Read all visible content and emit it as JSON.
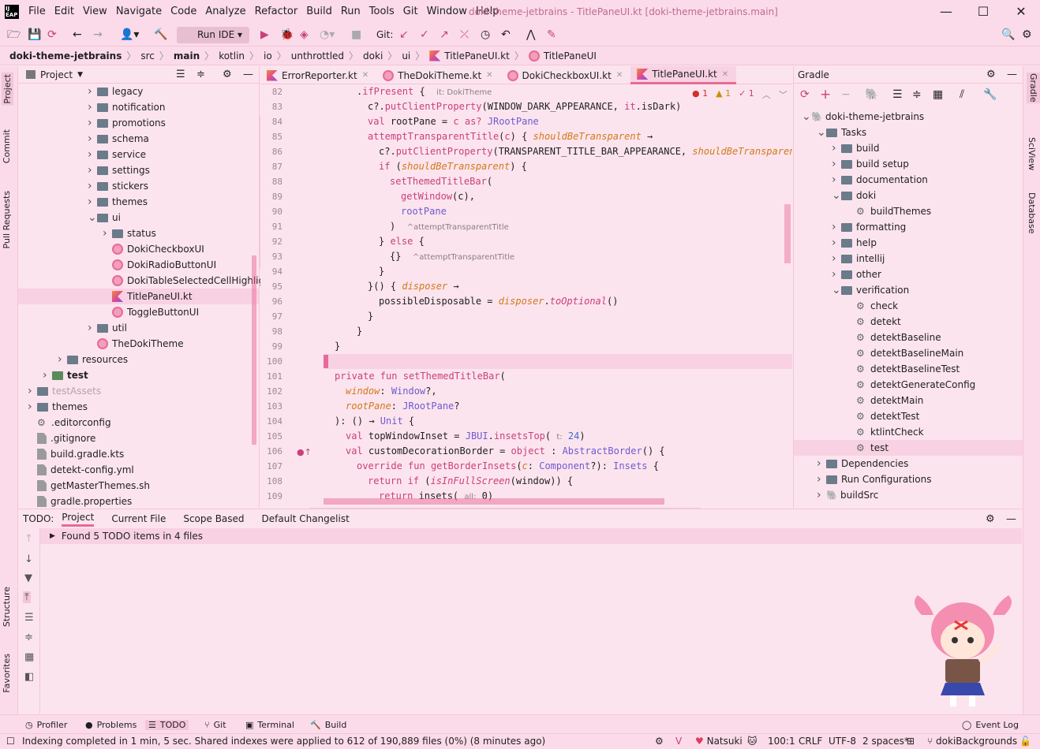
{
  "window": {
    "logo": "IJ EAP",
    "title": "doki-theme-jetbrains - TitlePaneUI.kt [doki-theme-jetbrains.main]",
    "min": "—",
    "max": "☐",
    "close": "✕"
  },
  "menu": [
    "File",
    "Edit",
    "View",
    "Navigate",
    "Code",
    "Analyze",
    "Refactor",
    "Build",
    "Run",
    "Tools",
    "Git",
    "Window",
    "Help"
  ],
  "toolbar": {
    "run_config": "Run IDE",
    "git_label": "Git:"
  },
  "breadcrumb": [
    "doki-theme-jetbrains",
    "src",
    "main",
    "kotlin",
    "io",
    "unthrottled",
    "doki",
    "ui",
    "TitlePaneUI.kt",
    "TitlePaneUI"
  ],
  "left_strip": [
    "Project",
    "Commit",
    "Pull Requests",
    "Structure",
    "Favorites"
  ],
  "right_strip": [
    "Gradle",
    "SciView",
    "Database"
  ],
  "project": {
    "title": "Project",
    "items": [
      {
        "label": "legacy",
        "type": "folder"
      },
      {
        "label": "notification",
        "type": "folder"
      },
      {
        "label": "promotions",
        "type": "folder"
      },
      {
        "label": "schema",
        "type": "folder"
      },
      {
        "label": "service",
        "type": "folder"
      },
      {
        "label": "settings",
        "type": "folder"
      },
      {
        "label": "stickers",
        "type": "folder"
      },
      {
        "label": "themes",
        "type": "folder"
      },
      {
        "label": "ui",
        "type": "folder"
      },
      {
        "label": "status",
        "type": "folder"
      },
      {
        "label": "DokiCheckboxUI",
        "type": "class"
      },
      {
        "label": "DokiRadioButtonUI",
        "type": "class"
      },
      {
        "label": "DokiTableSelectedCellHighlightBorder",
        "type": "class"
      },
      {
        "label": "TitlePaneUI.kt",
        "type": "kt"
      },
      {
        "label": "ToggleButtonUI",
        "type": "class"
      },
      {
        "label": "util",
        "type": "folder"
      },
      {
        "label": "TheDokiTheme",
        "type": "class"
      },
      {
        "label": "resources",
        "type": "folder"
      },
      {
        "label": "test",
        "type": "testfolder"
      },
      {
        "label": "testAssets",
        "type": "folder"
      },
      {
        "label": "themes",
        "type": "folder"
      },
      {
        "label": ".editorconfig",
        "type": "gear"
      },
      {
        "label": ".gitignore",
        "type": "file"
      },
      {
        "label": "build.gradle.kts",
        "type": "file"
      },
      {
        "label": "detekt-config.yml",
        "type": "file"
      },
      {
        "label": "getMasterThemes.sh",
        "type": "file"
      },
      {
        "label": "gradle.properties",
        "type": "file"
      }
    ]
  },
  "tabs": [
    {
      "label": "ErrorReporter.kt"
    },
    {
      "label": "TheDokiTheme.kt"
    },
    {
      "label": "DokiCheckboxUI.kt"
    },
    {
      "label": "TitlePaneUI.kt"
    }
  ],
  "editor": {
    "inspections": {
      "errors": "1",
      "warnings": "1",
      "typos": "1"
    },
    "line_numbers": [
      "82",
      "83",
      "84",
      "85",
      "86",
      "87",
      "88",
      "89",
      "90",
      "91",
      "92",
      "93",
      "94",
      "95",
      "96",
      "97",
      "98",
      "99",
      "100",
      "101",
      "102",
      "103",
      "104",
      "105",
      "106",
      "107",
      "108",
      "109"
    ],
    "hints": {
      "it_doki": "it: DokiTheme",
      "attempt1": "^attemptTransparentTitle",
      "attempt2": "^attemptTransparentTitle",
      "t_hint": "t:",
      "all_hint": "all:"
    }
  },
  "gradle": {
    "title": "Gradle",
    "items": [
      "doki-theme-jetbrains",
      "Tasks",
      "build",
      "build setup",
      "documentation",
      "doki",
      "buildThemes",
      "formatting",
      "help",
      "intellij",
      "other",
      "verification",
      "check",
      "detekt",
      "detektBaseline",
      "detektBaselineMain",
      "detektBaselineTest",
      "detektGenerateConfig",
      "detektMain",
      "detektTest",
      "ktlintCheck",
      "test",
      "Dependencies",
      "Run Configurations",
      "buildSrc"
    ]
  },
  "todo": {
    "label": "TODO:",
    "tabs": [
      "Project",
      "Current File",
      "Scope Based",
      "Default Changelist"
    ],
    "summary": "Found 5 TODO items in 4 files"
  },
  "toolwindows": [
    "Profiler",
    "Problems",
    "TODO",
    "Git",
    "Terminal",
    "Build",
    "Event Log"
  ],
  "status": {
    "message": "Indexing completed in 1 min, 5 sec. Shared indexes were applied to 612 of 190,889 files (0%) (8 minutes ago)",
    "theme": "Natsuki",
    "position": "100:1",
    "line_sep": "CRLF",
    "encoding": "UTF-8",
    "indent": "2 spaces*",
    "branch": "dokiBackgrounds"
  },
  "colors": {
    "accent": "#e86a96",
    "background": "#fce4ee",
    "keyword": "#c9407a"
  }
}
